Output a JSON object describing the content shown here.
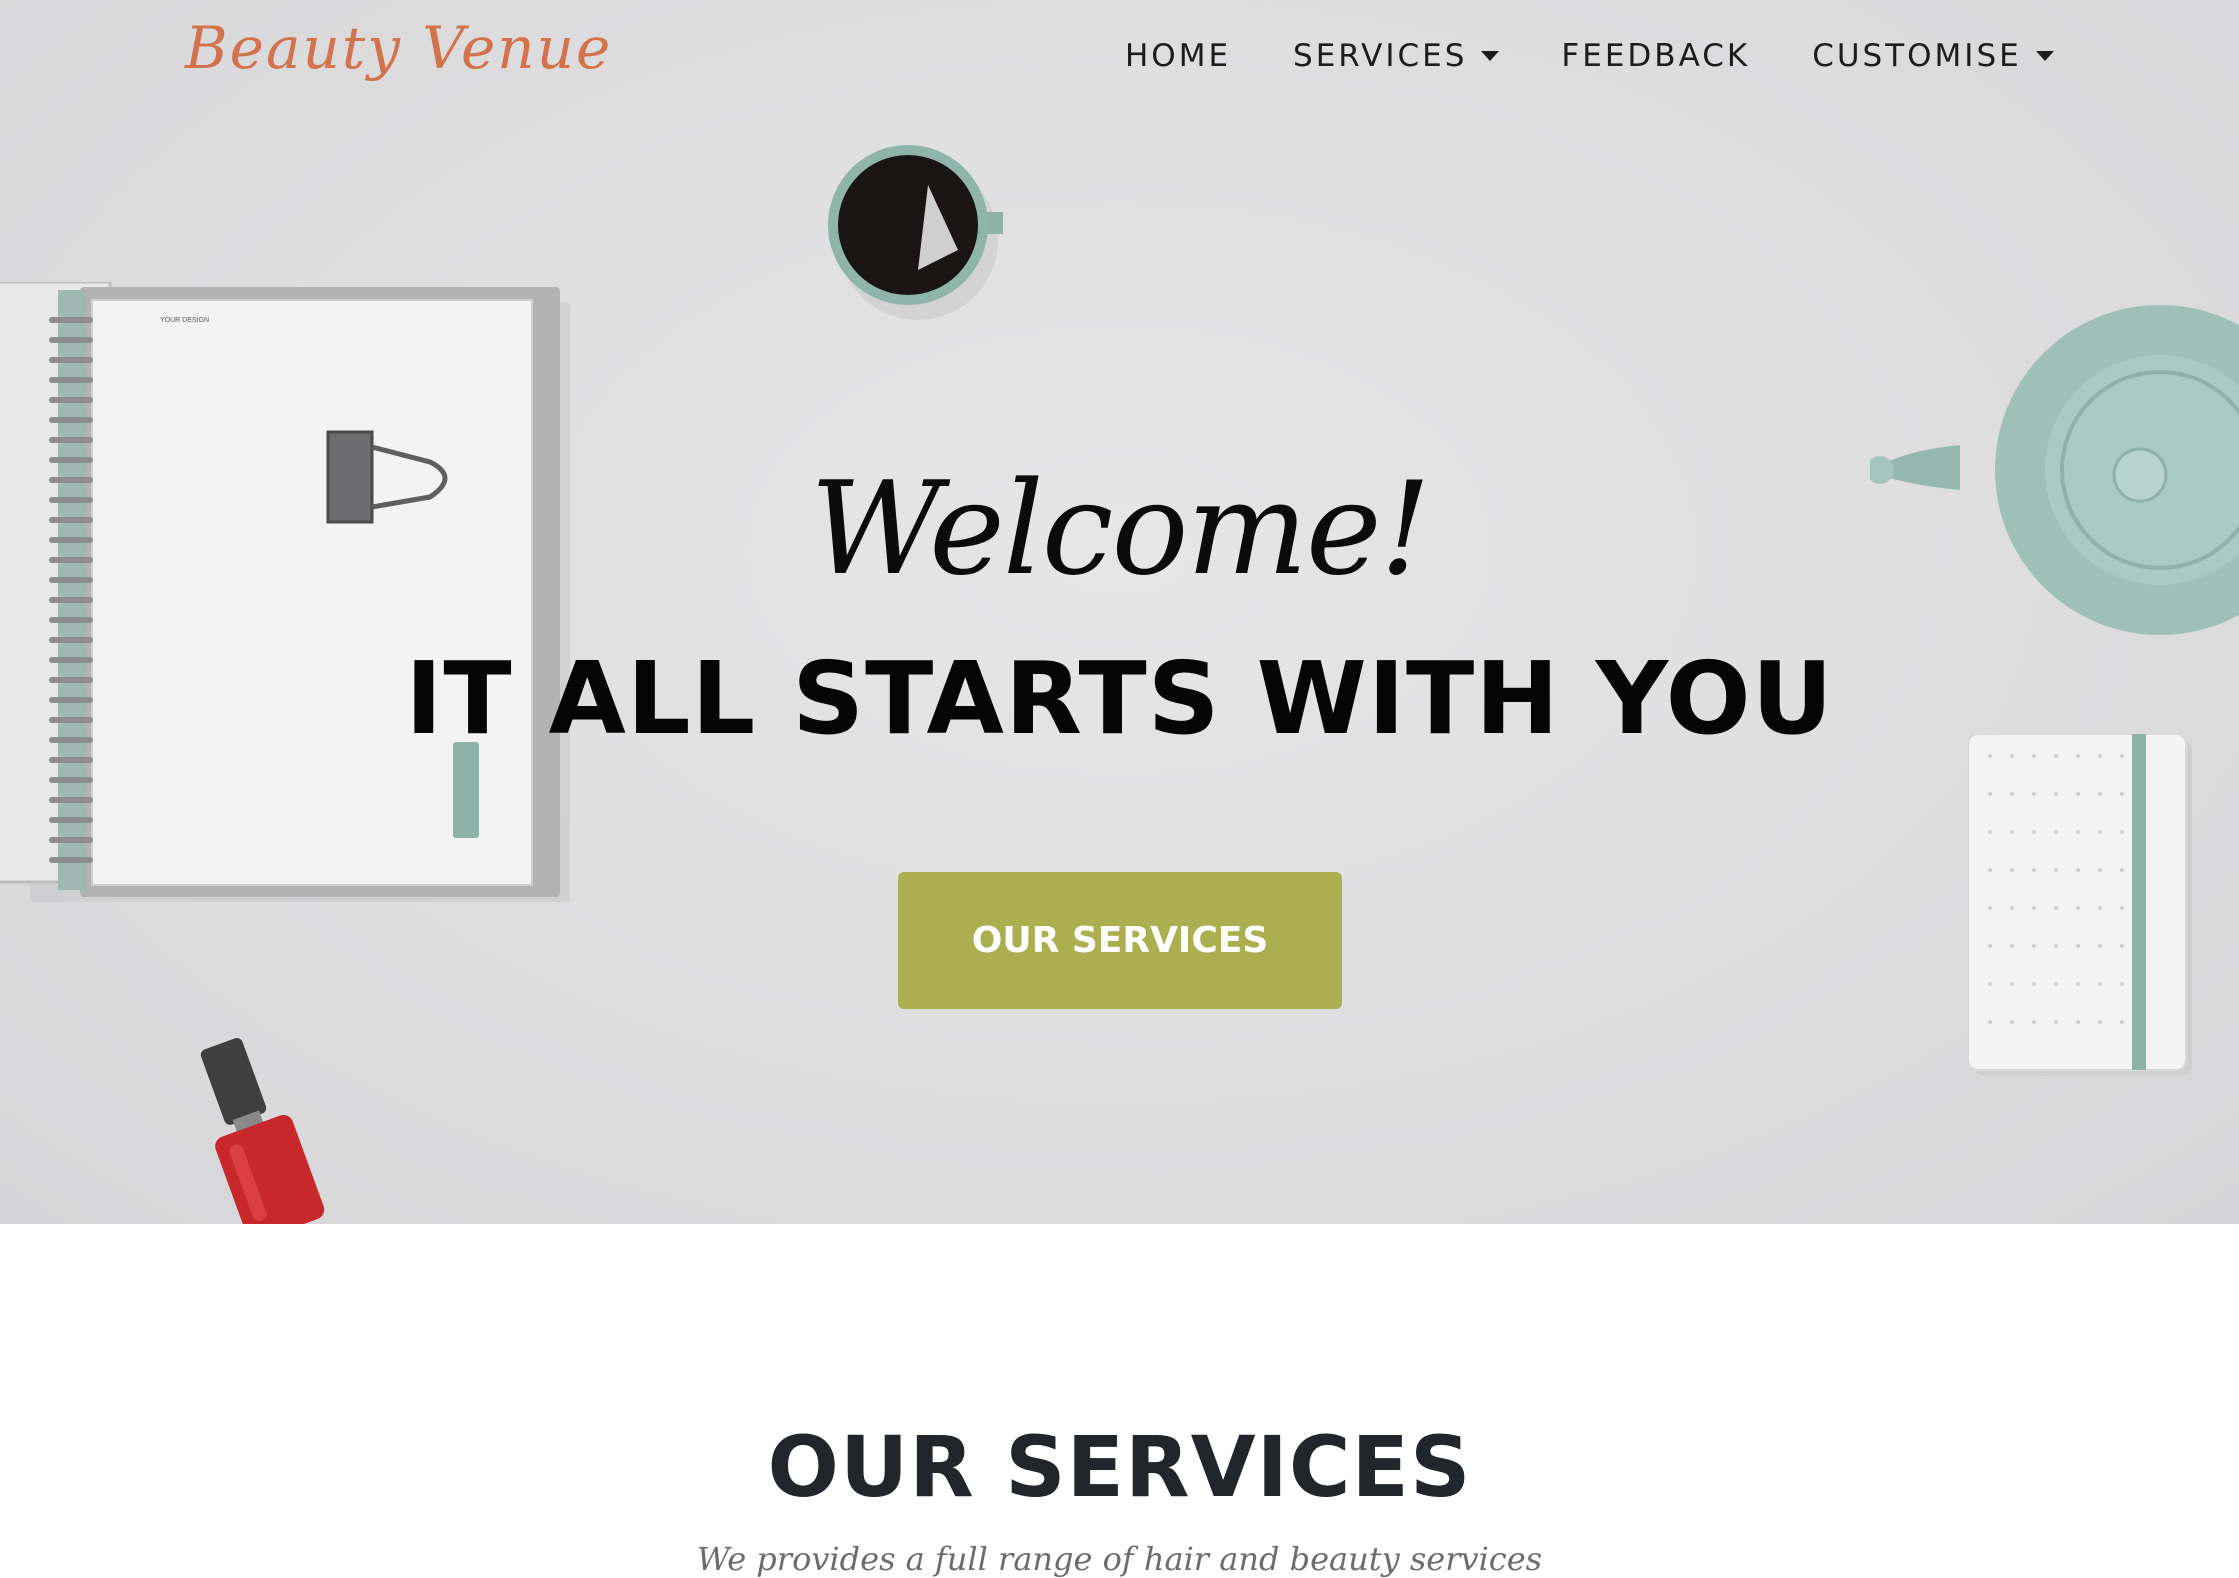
{
  "brand": {
    "name": "Beauty Venue",
    "color": "#d3734e"
  },
  "nav": {
    "items": [
      {
        "label": "HOME",
        "dropdown": false
      },
      {
        "label": "SERVICES",
        "dropdown": true
      },
      {
        "label": "FEEDBACK",
        "dropdown": false
      },
      {
        "label": "CUSTOMISE",
        "dropdown": true
      }
    ]
  },
  "hero": {
    "welcome": "Welcome!",
    "tagline": "IT ALL STARTS WITH YOU",
    "button_label": "OUR SERVICES",
    "button_color": "#abaf50",
    "notebook_label": "YOUR DESIGN"
  },
  "services": {
    "title": "OUR SERVICES",
    "subtitle": "We provides a full range of hair and beauty services"
  }
}
